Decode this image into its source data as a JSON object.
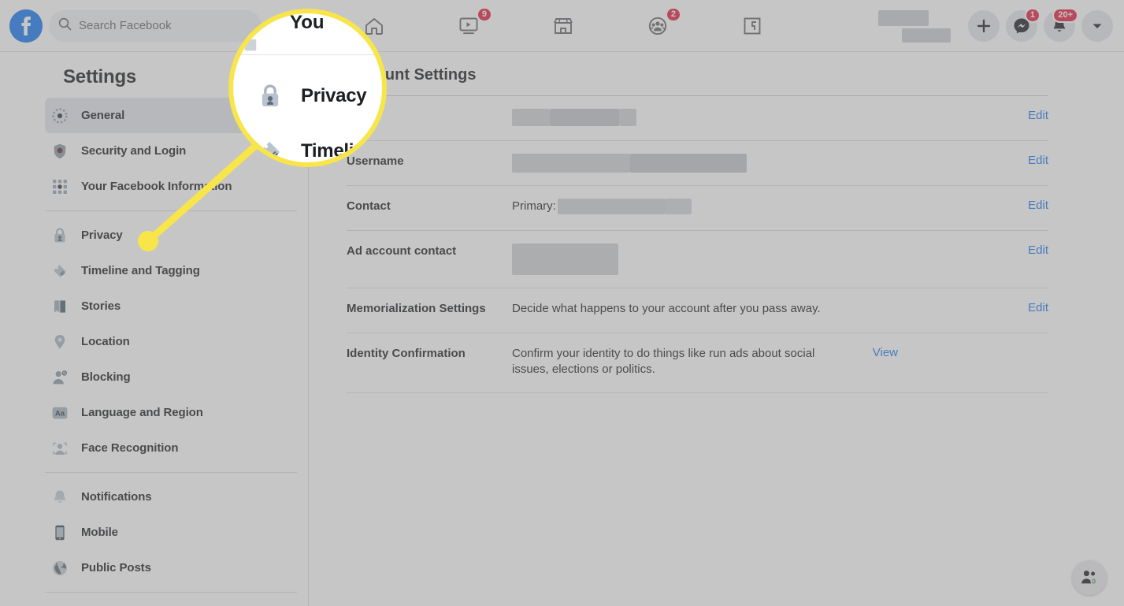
{
  "topnav": {
    "logo_icon": "facebook-logo-icon",
    "search": {
      "placeholder": "Search Facebook",
      "value": "",
      "icon": "search-icon"
    },
    "tabs": [
      {
        "name": "home",
        "icon": "home-icon",
        "badge": ""
      },
      {
        "name": "watch",
        "icon": "video-play-icon",
        "badge": "9"
      },
      {
        "name": "marketplace",
        "icon": "storefront-icon",
        "badge": ""
      },
      {
        "name": "groups",
        "icon": "groups-people-icon",
        "badge": "2"
      },
      {
        "name": "gaming",
        "icon": "gaming-controller-icon",
        "badge": ""
      }
    ],
    "profile_name_redacted": true,
    "actions": [
      {
        "name": "create",
        "icon": "plus-icon",
        "badge": ""
      },
      {
        "name": "messenger",
        "icon": "messenger-icon",
        "badge": "1"
      },
      {
        "name": "notifications",
        "icon": "bell-icon",
        "badge": "20+"
      },
      {
        "name": "account-menu",
        "icon": "chevron-down-icon",
        "badge": ""
      }
    ]
  },
  "sidebar": {
    "title": "Settings",
    "groups": [
      {
        "items": [
          {
            "label": "General",
            "icon": "gear-icon",
            "active": true
          },
          {
            "label": "Security and Login",
            "icon": "shield-icon",
            "active": false
          },
          {
            "label": "Your Facebook Information",
            "icon": "grid-dots-icon",
            "active": false
          }
        ]
      },
      {
        "items": [
          {
            "label": "Privacy",
            "icon": "lock-icon",
            "active": false
          },
          {
            "label": "Timeline and Tagging",
            "icon": "tag-icon",
            "active": false
          },
          {
            "label": "Stories",
            "icon": "book-icon",
            "active": false
          },
          {
            "label": "Location",
            "icon": "map-pin-icon",
            "active": false
          },
          {
            "label": "Blocking",
            "icon": "person-blocked-icon",
            "active": false
          },
          {
            "label": "Language and Region",
            "icon": "language-aa-icon",
            "active": false
          },
          {
            "label": "Face Recognition",
            "icon": "face-scan-icon",
            "active": false
          }
        ]
      },
      {
        "items": [
          {
            "label": "Notifications",
            "icon": "bell-icon",
            "active": false
          },
          {
            "label": "Mobile",
            "icon": "phone-icon",
            "active": false
          },
          {
            "label": "Public Posts",
            "icon": "globe-icon",
            "active": false
          }
        ]
      }
    ]
  },
  "main": {
    "title": "Account Settings",
    "action_edit": "Edit",
    "action_view": "View",
    "rows": [
      {
        "label": "",
        "label_hidden_by_callout": true,
        "value": "",
        "value_redacted": true,
        "action": "Edit"
      },
      {
        "label": "Username",
        "value": "",
        "value_redacted": true,
        "action": "Edit"
      },
      {
        "label": "Contact",
        "value_prefix": "Primary:",
        "value": "",
        "value_redacted": true,
        "action": "Edit"
      },
      {
        "label": "Ad account contact",
        "value": "",
        "value_redacted": true,
        "action": "Edit"
      },
      {
        "label": "Memorialization Settings",
        "value": "Decide what happens to your account after you pass away.",
        "value_redacted": false,
        "action": "Edit"
      },
      {
        "label": "Identity Confirmation",
        "value": "Confirm your identity to do things like run ads about social issues, elections or politics.",
        "value_redacted": false,
        "action": "View"
      }
    ]
  },
  "chat_fab": {
    "icon": "contacts-people-icon",
    "badge": "0",
    "badge_color": "#31a24c"
  },
  "callout": {
    "highlight_color": "#f7e54a",
    "target_item": "Privacy",
    "magnified": {
      "partial_top_label": "You",
      "items": [
        {
          "label": "Privacy",
          "icon": "lock-icon"
        },
        {
          "label": "Timelin",
          "icon": "tag-icon"
        }
      ]
    }
  },
  "colors": {
    "brand_blue": "#1877f2",
    "link_blue": "#1877f2",
    "badge_red": "#e41e3f",
    "highlight_yellow": "#f7e54a",
    "green": "#31a24c",
    "text_primary": "#1c1e21",
    "text_secondary": "#65676b"
  }
}
